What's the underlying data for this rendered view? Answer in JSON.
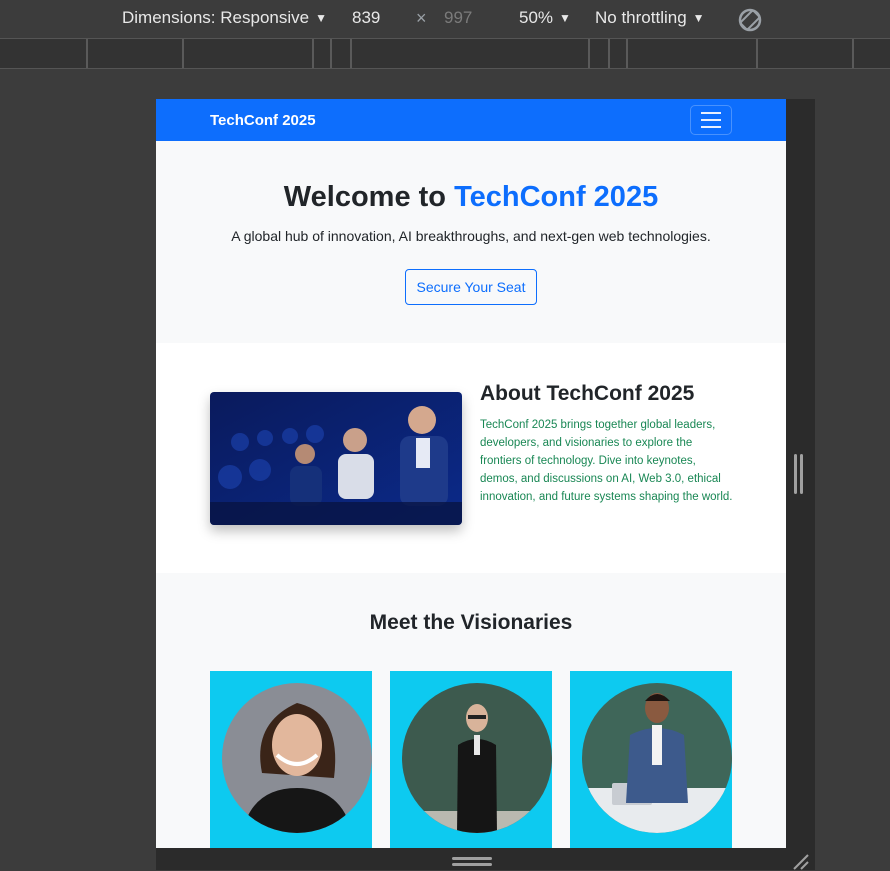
{
  "devtools": {
    "dimensions_label": "Dimensions: Responsive",
    "width": "839",
    "times": "×",
    "height": "997",
    "zoom": "50%",
    "throttling": "No throttling",
    "caret": "▼"
  },
  "page": {
    "brand": "TechConf 2025",
    "hero": {
      "title_prefix": "Welcome to ",
      "title_accent": "TechConf 2025",
      "subtitle": "A global hub of innovation, AI breakthroughs, and next-gen web technologies.",
      "cta": "Secure Your Seat"
    },
    "about": {
      "title": "About TechConf 2025",
      "body": "TechConf 2025 brings together global leaders, developers, and visionaries to explore the frontiers of technology. Dive into keynotes, demos, and discussions on AI, Web 3.0, ethical innovation, and future systems shaping the world."
    },
    "speakers": {
      "title": "Meet the Visionaries"
    }
  },
  "colors": {
    "primary": "#0d6efd",
    "info": "#0dcaf0",
    "success": "#198754",
    "light": "#f8f9fa"
  }
}
